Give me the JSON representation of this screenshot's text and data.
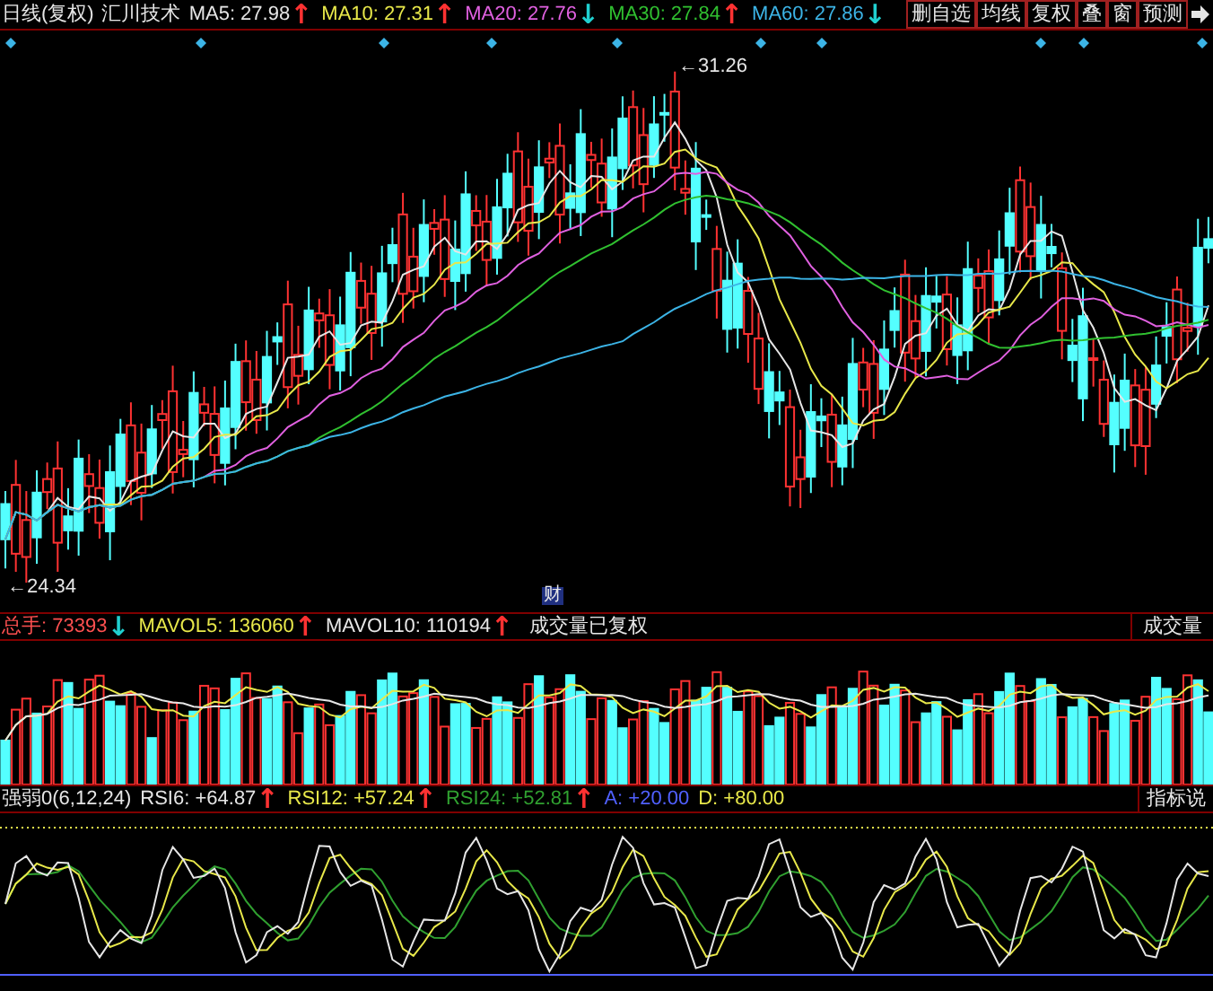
{
  "chart_header": {
    "period": "日线(复权)",
    "stock": "汇川技术",
    "indicators": [
      {
        "label": "MA5: 27.98",
        "color": "#e6e6e6",
        "arrow": {
          "text": "↑",
          "color": "#ff3232"
        }
      },
      {
        "label": "MA10: 27.31",
        "color": "#e8e84a",
        "arrow": {
          "text": "↑",
          "color": "#ff3232"
        }
      },
      {
        "label": "MA20: 27.76",
        "color": "#e060e0",
        "arrow": {
          "text": "↓",
          "color": "#20d0d0"
        }
      },
      {
        "label": "MA30: 27.84",
        "color": "#30c030",
        "arrow": {
          "text": "↑",
          "color": "#ff3232"
        }
      },
      {
        "label": "MA60: 27.86",
        "color": "#3cb4e6",
        "arrow": {
          "text": "↓",
          "color": "#20d0d0"
        }
      }
    ]
  },
  "toolbar": [
    "删自选",
    "均线",
    "复权",
    "叠",
    "窗",
    "预测"
  ],
  "main_chart": {
    "high_marker": "←31.26",
    "low_marker": "←24.34",
    "event_badge": "财"
  },
  "volume_panel": {
    "indicators": [
      {
        "label": "总手: 73393",
        "color": "#ff5050",
        "arrow": {
          "text": "↓",
          "color": "#20d0d0"
        }
      },
      {
        "label": "MAVOL5: 136060",
        "color": "#e8e84a",
        "arrow": {
          "text": "↑",
          "color": "#ff3232"
        }
      },
      {
        "label": "MAVOL10: 110194",
        "color": "#e6e6e6",
        "arrow": {
          "text": "↑",
          "color": "#ff3232"
        }
      }
    ],
    "note": "成交量已复权",
    "tab": "成交量"
  },
  "rsi_panel": {
    "indicators": [
      {
        "label": "强弱0(6,12,24)",
        "color": "#e6e6e6"
      },
      {
        "label": "RSI6: +64.87",
        "color": "#e6e6e6",
        "arrow": {
          "text": "↑",
          "color": "#ff3232"
        }
      },
      {
        "label": "RSI12: +57.24",
        "color": "#e8e84a",
        "arrow": {
          "text": "↑",
          "color": "#ff3232"
        }
      },
      {
        "label": "RSI24: +52.81",
        "color": "#30a030",
        "arrow": {
          "text": "↑",
          "color": "#ff3232"
        }
      },
      {
        "label": "A: +20.00",
        "color": "#5060ff"
      },
      {
        "label": "D: +80.00",
        "color": "#e8e84a"
      }
    ],
    "tab": "指标说"
  }
}
